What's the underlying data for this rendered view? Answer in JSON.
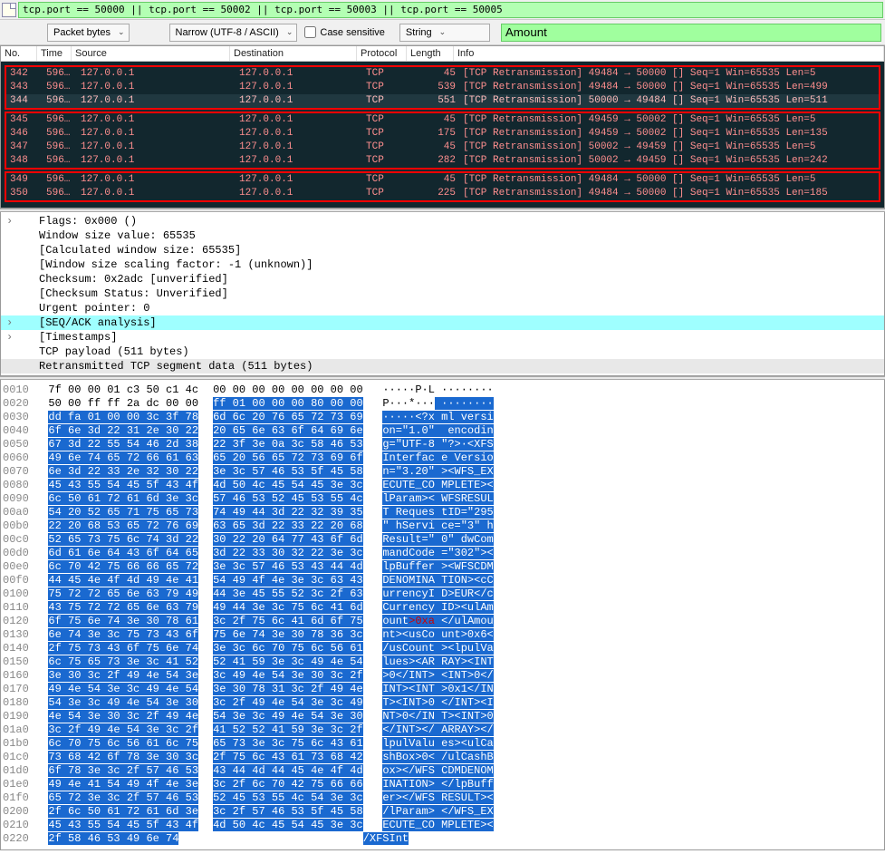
{
  "filter_text": "tcp.port == 50000 || tcp.port == 50002 || tcp.port == 50003 || tcp.port == 50005",
  "toolbar": {
    "packet_bytes": "Packet bytes",
    "encoding": "Narrow (UTF-8 / ASCII)",
    "case_sensitive": "Case sensitive",
    "data_type": "String",
    "search_value": "Amount"
  },
  "headers": {
    "no": "No.",
    "time": "Time",
    "src": "Source",
    "dst": "Destination",
    "proto": "Protocol",
    "len": "Length",
    "info": "Info"
  },
  "groups": [
    {
      "rows": [
        {
          "no": "342",
          "time": "596…",
          "src": "127.0.0.1",
          "dst": "127.0.0.1",
          "proto": "TCP",
          "len": "45",
          "info": "[TCP Retransmission] 49484 → 50000 [<None>] Seq=1 Win=65535 Len=5",
          "sel": false
        },
        {
          "no": "343",
          "time": "596…",
          "src": "127.0.0.1",
          "dst": "127.0.0.1",
          "proto": "TCP",
          "len": "539",
          "info": "[TCP Retransmission] 49484 → 50000 [<None>] Seq=1 Win=65535 Len=499",
          "sel": false
        },
        {
          "no": "344",
          "time": "596…",
          "src": "127.0.0.1",
          "dst": "127.0.0.1",
          "proto": "TCP",
          "len": "551",
          "info": "[TCP Retransmission] 50000 → 49484 [<None>] Seq=1 Win=65535 Len=511",
          "sel": true
        }
      ]
    },
    {
      "rows": [
        {
          "no": "345",
          "time": "596…",
          "src": "127.0.0.1",
          "dst": "127.0.0.1",
          "proto": "TCP",
          "len": "45",
          "info": "[TCP Retransmission] 49459 → 50002 [<None>] Seq=1 Win=65535 Len=5",
          "sel": false
        },
        {
          "no": "346",
          "time": "596…",
          "src": "127.0.0.1",
          "dst": "127.0.0.1",
          "proto": "TCP",
          "len": "175",
          "info": "[TCP Retransmission] 49459 → 50002 [<None>] Seq=1 Win=65535 Len=135",
          "sel": false
        },
        {
          "no": "347",
          "time": "596…",
          "src": "127.0.0.1",
          "dst": "127.0.0.1",
          "proto": "TCP",
          "len": "45",
          "info": "[TCP Retransmission] 50002 → 49459 [<None>] Seq=1 Win=65535 Len=5",
          "sel": false
        },
        {
          "no": "348",
          "time": "596…",
          "src": "127.0.0.1",
          "dst": "127.0.0.1",
          "proto": "TCP",
          "len": "282",
          "info": "[TCP Retransmission] 50002 → 49459 [<None>] Seq=1 Win=65535 Len=242",
          "sel": false
        }
      ]
    },
    {
      "rows": [
        {
          "no": "349",
          "time": "596…",
          "src": "127.0.0.1",
          "dst": "127.0.0.1",
          "proto": "TCP",
          "len": "45",
          "info": "[TCP Retransmission] 49484 → 50000 [<None>] Seq=1 Win=65535 Len=5",
          "sel": false
        },
        {
          "no": "350",
          "time": "596…",
          "src": "127.0.0.1",
          "dst": "127.0.0.1",
          "proto": "TCP",
          "len": "225",
          "info": "[TCP Retransmission] 49484 → 50000 [<None>] Seq=1 Win=65535 Len=185",
          "sel": false
        }
      ]
    }
  ],
  "tree": [
    {
      "tri": "›",
      "txt": "Flags: 0x000 (<None>)"
    },
    {
      "tri": "",
      "txt": "Window size value: 65535"
    },
    {
      "tri": "",
      "txt": "[Calculated window size: 65535]"
    },
    {
      "tri": "",
      "txt": "[Window size scaling factor: -1 (unknown)]"
    },
    {
      "tri": "",
      "txt": "Checksum: 0x2adc [unverified]"
    },
    {
      "tri": "",
      "txt": "[Checksum Status: Unverified]"
    },
    {
      "tri": "",
      "txt": "Urgent pointer: 0"
    },
    {
      "tri": "›",
      "txt": "[SEQ/ACK analysis]",
      "hl": true
    },
    {
      "tri": "›",
      "txt": "[Timestamps]"
    },
    {
      "tri": "",
      "txt": "TCP payload (511 bytes)"
    },
    {
      "tri": "",
      "txt": "Retransmitted TCP segment data (511 bytes)",
      "sel": true
    }
  ],
  "hex": [
    {
      "o": "0010",
      "h1": "7f 00 00 01 c3 50 c1 4c",
      "h2": "00 00 00 00 00 00 00 00",
      "a1": "·····P·L",
      "a2": " ········",
      "p1": 0,
      "p2": 0
    },
    {
      "o": "0020",
      "h1": "50 00 ff ff 2a dc 00 00",
      "h2": "ff 01 00 00 00 80 00 00",
      "a1": "P···*···",
      "a2": " ········",
      "p1": 0,
      "p2": 1
    },
    {
      "o": "0030",
      "h1": "dd fa 01 00 00 3c 3f 78",
      "h2": "6d 6c 20 76 65 72 73 69",
      "a1": "·····<?x",
      "a2": " ml versi",
      "p1": 1,
      "p2": 1
    },
    {
      "o": "0040",
      "h1": "6f 6e 3d 22 31 2e 30 22",
      "h2": "20 65 6e 63 6f 64 69 6e",
      "a1": "on=\"1.0\"",
      "a2": "  encodin",
      "p1": 1,
      "p2": 1
    },
    {
      "o": "0050",
      "h1": "67 3d 22 55 54 46 2d 38",
      "h2": "22 3f 3e 0a 3c 58 46 53",
      "a1": "g=\"UTF-8",
      "a2": " \"?>·<XFS",
      "p1": 1,
      "p2": 1
    },
    {
      "o": "0060",
      "h1": "49 6e 74 65 72 66 61 63",
      "h2": "65 20 56 65 72 73 69 6f",
      "a1": "Interfac",
      "a2": " e Versio",
      "p1": 1,
      "p2": 1
    },
    {
      "o": "0070",
      "h1": "6e 3d 22 33 2e 32 30 22",
      "h2": "3e 3c 57 46 53 5f 45 58",
      "a1": "n=\"3.20\"",
      "a2": " ><WFS_EX",
      "p1": 1,
      "p2": 1
    },
    {
      "o": "0080",
      "h1": "45 43 55 54 45 5f 43 4f",
      "h2": "4d 50 4c 45 54 45 3e 3c",
      "a1": "ECUTE_CO",
      "a2": " MPLETE><",
      "p1": 1,
      "p2": 1
    },
    {
      "o": "0090",
      "h1": "6c 50 61 72 61 6d 3e 3c",
      "h2": "57 46 53 52 45 53 55 4c",
      "a1": "lParam><",
      "a2": " WFSRESUL",
      "p1": 1,
      "p2": 1
    },
    {
      "o": "00a0",
      "h1": "54 20 52 65 71 75 65 73",
      "h2": "74 49 44 3d 22 32 39 35",
      "a1": "T Reques",
      "a2": " tID=\"295",
      "p1": 1,
      "p2": 1
    },
    {
      "o": "00b0",
      "h1": "22 20 68 53 65 72 76 69",
      "h2": "63 65 3d 22 33 22 20 68",
      "a1": "\" hServi",
      "a2": " ce=\"3\" h",
      "p1": 1,
      "p2": 1
    },
    {
      "o": "00c0",
      "h1": "52 65 73 75 6c 74 3d 22",
      "h2": "30 22 20 64 77 43 6f 6d",
      "a1": "Result=\"",
      "a2": " 0\" dwCom",
      "p1": 1,
      "p2": 1
    },
    {
      "o": "00d0",
      "h1": "6d 61 6e 64 43 6f 64 65",
      "h2": "3d 22 33 30 32 22 3e 3c",
      "a1": "mandCode",
      "a2": " =\"302\"><",
      "p1": 1,
      "p2": 1
    },
    {
      "o": "00e0",
      "h1": "6c 70 42 75 66 66 65 72",
      "h2": "3e 3c 57 46 53 43 44 4d",
      "a1": "lpBuffer",
      "a2": " ><WFSCDM",
      "p1": 1,
      "p2": 1
    },
    {
      "o": "00f0",
      "h1": "44 45 4e 4f 4d 49 4e 41",
      "h2": "54 49 4f 4e 3e 3c 63 43",
      "a1": "DENOMINA",
      "a2": " TION><cC",
      "p1": 1,
      "p2": 1
    },
    {
      "o": "0100",
      "h1": "75 72 72 65 6e 63 79 49",
      "h2": "44 3e 45 55 52 3c 2f 63",
      "a1": "urrencyI",
      "a2": " D>EUR</c",
      "p1": 1,
      "p2": 1
    },
    {
      "o": "0110",
      "h1": "43 75 72 72 65 6e 63 79",
      "h2": "49 44 3e 3c 75 6c 41 6d",
      "a1": "Currency",
      "a2": " ID><ulAm",
      "p1": 1,
      "p2": 1
    },
    {
      "o": "0120",
      "h1": "6f 75 6e 74 3e 30 78 61",
      "h2": "3c 2f 75 6c 41 6d 6f 75",
      "a1": "ount>0xa",
      "a2": " </ulAmou",
      "p1": 1,
      "p2": 1,
      "red": ">0xa"
    },
    {
      "o": "0130",
      "h1": "6e 74 3e 3c 75 73 43 6f",
      "h2": "75 6e 74 3e 30 78 36 3c",
      "a1": "nt><usCo",
      "a2": " unt>0x6<",
      "p1": 1,
      "p2": 1
    },
    {
      "o": "0140",
      "h1": "2f 75 73 43 6f 75 6e 74",
      "h2": "3e 3c 6c 70 75 6c 56 61",
      "a1": "/usCount",
      "a2": " ><lpulVa",
      "p1": 1,
      "p2": 1
    },
    {
      "o": "0150",
      "h1": "6c 75 65 73 3e 3c 41 52",
      "h2": "52 41 59 3e 3c 49 4e 54",
      "a1": "lues><AR",
      "a2": " RAY><INT",
      "p1": 1,
      "p2": 1
    },
    {
      "o": "0160",
      "h1": "3e 30 3c 2f 49 4e 54 3e",
      "h2": "3c 49 4e 54 3e 30 3c 2f",
      "a1": ">0</INT>",
      "a2": " <INT>0</",
      "p1": 1,
      "p2": 1
    },
    {
      "o": "0170",
      "h1": "49 4e 54 3e 3c 49 4e 54",
      "h2": "3e 30 78 31 3c 2f 49 4e",
      "a1": "INT><INT",
      "a2": " >0x1</IN",
      "p1": 1,
      "p2": 1
    },
    {
      "o": "0180",
      "h1": "54 3e 3c 49 4e 54 3e 30",
      "h2": "3c 2f 49 4e 54 3e 3c 49",
      "a1": "T><INT>0",
      "a2": " </INT><I",
      "p1": 1,
      "p2": 1
    },
    {
      "o": "0190",
      "h1": "4e 54 3e 30 3c 2f 49 4e",
      "h2": "54 3e 3c 49 4e 54 3e 30",
      "a1": "NT>0</IN",
      "a2": " T><INT>0",
      "p1": 1,
      "p2": 1
    },
    {
      "o": "01a0",
      "h1": "3c 2f 49 4e 54 3e 3c 2f",
      "h2": "41 52 52 41 59 3e 3c 2f",
      "a1": "</INT></",
      "a2": " ARRAY></",
      "p1": 1,
      "p2": 1
    },
    {
      "o": "01b0",
      "h1": "6c 70 75 6c 56 61 6c 75",
      "h2": "65 73 3e 3c 75 6c 43 61",
      "a1": "lpulValu",
      "a2": " es><ulCa",
      "p1": 1,
      "p2": 1
    },
    {
      "o": "01c0",
      "h1": "73 68 42 6f 78 3e 30 3c",
      "h2": "2f 75 6c 43 61 73 68 42",
      "a1": "shBox>0<",
      "a2": " /ulCashB",
      "p1": 1,
      "p2": 1
    },
    {
      "o": "01d0",
      "h1": "6f 78 3e 3c 2f 57 46 53",
      "h2": "43 44 4d 44 45 4e 4f 4d",
      "a1": "ox></WFS",
      "a2": " CDMDENOM",
      "p1": 1,
      "p2": 1
    },
    {
      "o": "01e0",
      "h1": "49 4e 41 54 49 4f 4e 3e",
      "h2": "3c 2f 6c 70 42 75 66 66",
      "a1": "INATION>",
      "a2": " </lpBuff",
      "p1": 1,
      "p2": 1
    },
    {
      "o": "01f0",
      "h1": "65 72 3e 3c 2f 57 46 53",
      "h2": "52 45 53 55 4c 54 3e 3c",
      "a1": "er></WFS",
      "a2": " RESULT><",
      "p1": 1,
      "p2": 1
    },
    {
      "o": "0200",
      "h1": "2f 6c 50 61 72 61 6d 3e",
      "h2": "3c 2f 57 46 53 5f 45 58",
      "a1": "/lParam>",
      "a2": " </WFS_EX",
      "p1": 1,
      "p2": 1
    },
    {
      "o": "0210",
      "h1": "45 43 55 54 45 5f 43 4f",
      "h2": "4d 50 4c 45 54 45 3e 3c",
      "a1": "ECUTE_CO",
      "a2": " MPLETE><",
      "p1": 1,
      "p2": 1
    },
    {
      "o": "0220",
      "h1": "2f 58 46 53 49 6e 74",
      "h2": "",
      "a1": "/XFSInt",
      "a2": "",
      "p1": 1,
      "p2": 0
    }
  ]
}
